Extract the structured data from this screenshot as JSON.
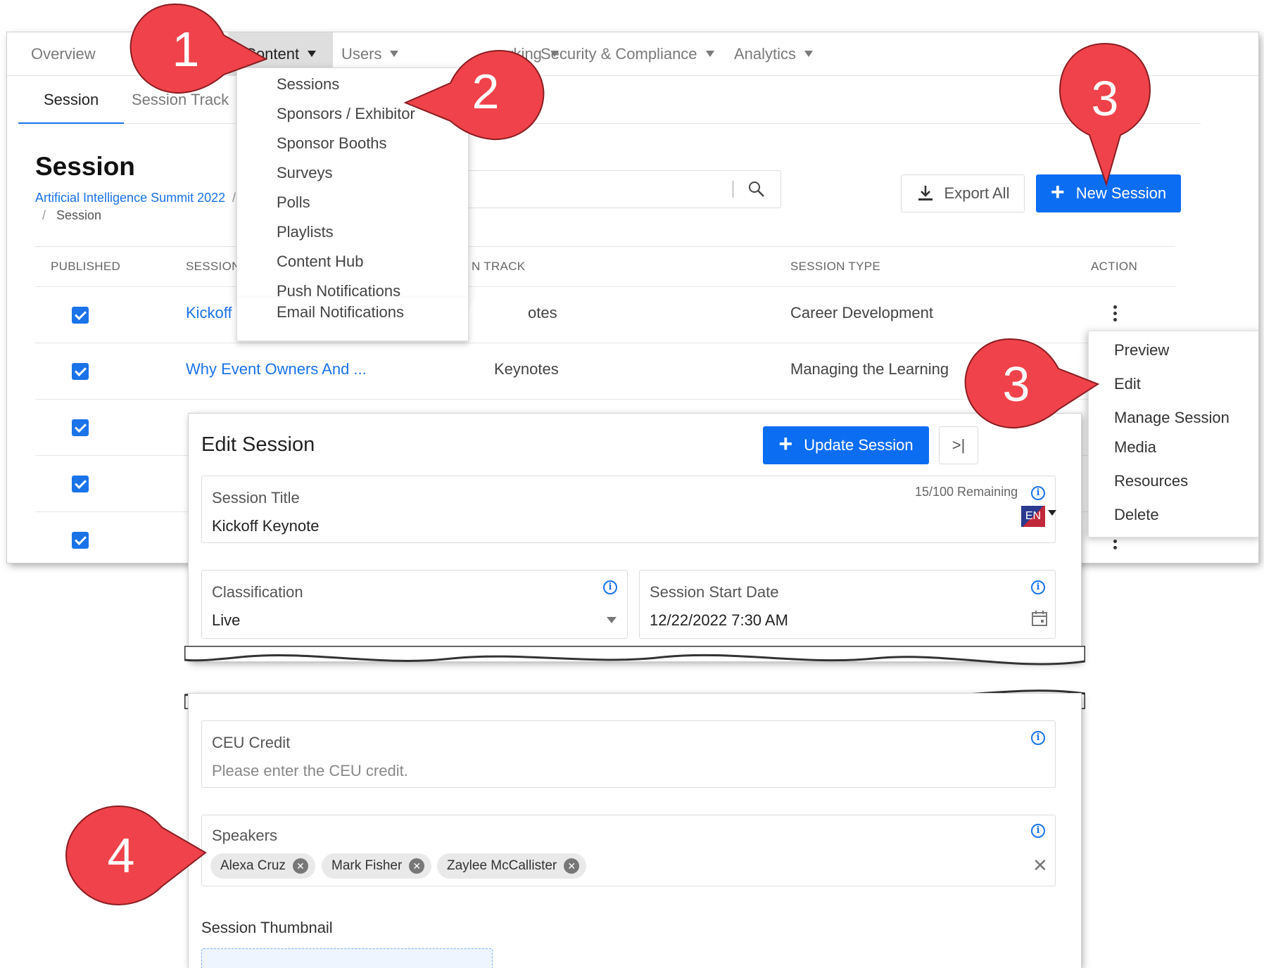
{
  "topnav": {
    "items": [
      {
        "label": "Overview"
      },
      {
        "label": "Content"
      },
      {
        "label": "Users"
      },
      {
        "label": "orking"
      },
      {
        "label": "Security & Compliance"
      },
      {
        "label": "Analytics"
      }
    ],
    "active": "Content"
  },
  "subtabs": [
    "Session",
    "Session Track"
  ],
  "page": {
    "title": "Session",
    "breadcrumb_event": "Artificial Intelligence Summit 2022",
    "breadcrumb_sep": "/",
    "breadcrumb_current": "Session"
  },
  "search": {
    "partial_placeholder": "e"
  },
  "toolbar": {
    "export_label": "Export All",
    "new_label": "New Session"
  },
  "table": {
    "headers": [
      "PUBLISHED",
      "SESSION TITL",
      "N TRACK",
      "SESSION TYPE",
      "ACTION"
    ],
    "rows": [
      {
        "published": true,
        "title": "Kickoff Key",
        "track": "otes",
        "type": "Career Development"
      },
      {
        "published": true,
        "title": "Why Event Owners And ...",
        "track": "Keynotes",
        "type": "Managing the Learning"
      },
      {
        "published": true,
        "title": "",
        "track": "",
        "type": ""
      },
      {
        "published": true,
        "title": "",
        "track": "",
        "type": ""
      },
      {
        "published": true,
        "title": "",
        "track": "",
        "type": ""
      }
    ]
  },
  "content_menu": {
    "items": [
      "Sessions",
      "Sponsors / Exhibitor",
      "Sponsor Booths",
      "Surveys",
      "Polls",
      "Playlists",
      "Content Hub",
      "Push Notifications",
      "Email Notifications"
    ]
  },
  "action_menu": {
    "items": [
      "Preview",
      "Edit",
      "Manage Session",
      "Media",
      "Resources",
      "Delete"
    ]
  },
  "edit_session": {
    "title": "Edit Session",
    "update_label": "Update Session",
    "collapse_label": ">|",
    "session_title": {
      "label": "Session Title",
      "value": "Kickoff Keynote",
      "remaining": "15/100 Remaining",
      "lang": "EN"
    },
    "classification": {
      "label": "Classification",
      "value": "Live"
    },
    "start_date": {
      "label": "Session Start Date",
      "value": "12/22/2022 7:30 AM"
    },
    "ceu": {
      "label": "CEU Credit",
      "placeholder": "Please enter the CEU credit."
    },
    "speakers": {
      "label": "Speakers",
      "chips": [
        "Alexa Cruz",
        "Mark Fisher",
        "Zaylee McCallister"
      ]
    },
    "thumbnail_label": "Session Thumbnail"
  },
  "callouts": [
    "1",
    "2",
    "3",
    "3",
    "4"
  ],
  "colors": {
    "accent": "#0b6df2",
    "callout": "#f0424a",
    "link": "#1a73e8"
  }
}
